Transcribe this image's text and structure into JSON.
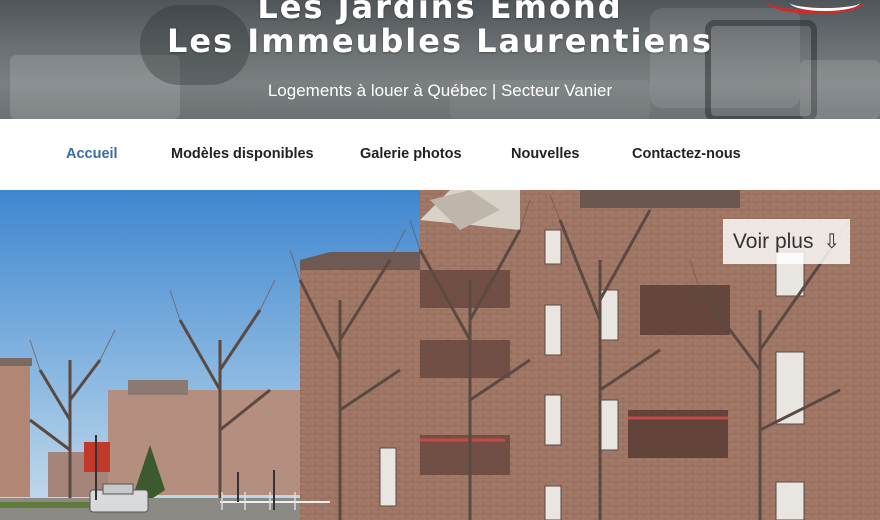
{
  "header": {
    "title_line1": "Les Jardins Émond",
    "title_line2": "Les Immeubles Laurentiens",
    "tagline": "Logements à louer à Québec | Secteur Vanier"
  },
  "nav": {
    "items": [
      {
        "label": "Accueil",
        "active": true
      },
      {
        "label": "Modèles disponibles"
      },
      {
        "label": "Galerie photos"
      },
      {
        "label": "Nouvelles"
      },
      {
        "label": "Contactez-nous"
      }
    ]
  },
  "hero": {
    "cta_label": "Voir plus",
    "cta_icon": "⇩",
    "image": "brick-apartment-building-photo"
  },
  "colors": {
    "nav_active": "#3b6aa5",
    "nav_text": "#222222",
    "header_text": "#ffffff",
    "brick": "#9a7462",
    "sky": "#9ec3e4"
  }
}
